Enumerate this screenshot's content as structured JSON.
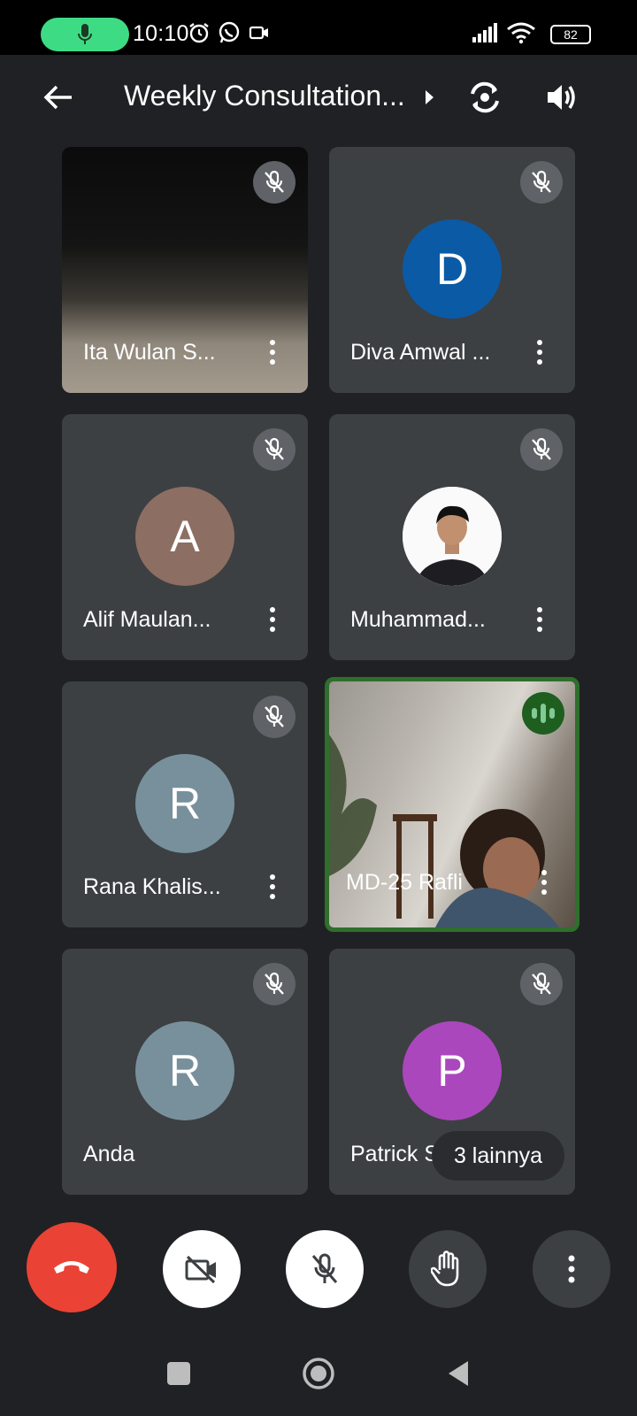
{
  "status_bar": {
    "time": "10:10",
    "battery": "82",
    "icons": [
      "mic-icon",
      "alarm-icon",
      "whatsapp-icon",
      "video-icon",
      "signal-icon",
      "wifi-icon",
      "battery-icon"
    ]
  },
  "header": {
    "title": "Weekly Consultation...",
    "icons": [
      "back-arrow-icon",
      "chevron-right-icon",
      "switch-camera-icon",
      "speaker-icon"
    ]
  },
  "participants": [
    {
      "name": "Ita Wulan S...",
      "type": "video",
      "muted": true
    },
    {
      "name": "Diva Amwal ...",
      "initial": "D",
      "color": "#0b5aa5",
      "muted": true
    },
    {
      "name": "Alif Maulan...",
      "initial": "A",
      "color": "#8d6e63",
      "muted": true
    },
    {
      "name": "Muhammad...",
      "type": "photo",
      "muted": true
    },
    {
      "name": "Rana Khalis...",
      "initial": "R",
      "color": "#78909c",
      "muted": true
    },
    {
      "name": "MD-25 Rafli",
      "type": "video",
      "speaking": true
    },
    {
      "name": "Anda",
      "initial": "R",
      "color": "#78909c",
      "muted": true
    },
    {
      "name": "Patrick S...",
      "initial": "P",
      "color": "#ab47bc",
      "muted": true
    }
  ],
  "more_chip": "3 lainnya",
  "controls": [
    "end-call-button",
    "camera-off-button",
    "mic-off-button",
    "raise-hand-button",
    "more-options-button"
  ],
  "colors": {
    "end_call": "#ea4335",
    "speaking_border": "#2f6e2c",
    "mic_pill": "#3ddc84"
  }
}
